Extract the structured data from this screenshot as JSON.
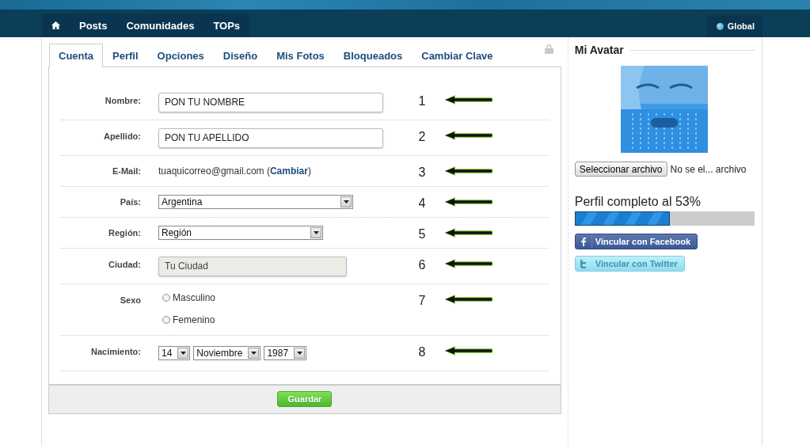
{
  "nav": {
    "items": [
      {
        "kind": "home",
        "selected": false
      },
      {
        "kind": "text",
        "label": "Posts",
        "selected": false
      },
      {
        "kind": "text",
        "label": "Comunidades",
        "selected": false
      },
      {
        "kind": "text",
        "label": "TOPs",
        "selected": false
      }
    ],
    "region_button": {
      "label": "Global"
    }
  },
  "tabs": [
    {
      "label": "Cuenta",
      "selected": true
    },
    {
      "label": "Perfil",
      "selected": false
    },
    {
      "label": "Opciones",
      "selected": false
    },
    {
      "label": "Diseño",
      "selected": false
    },
    {
      "label": "Mis Fotos",
      "selected": false
    },
    {
      "label": "Bloqueados",
      "selected": false
    },
    {
      "label": "Cambiar Clave",
      "selected": false
    }
  ],
  "form": {
    "rows": [
      {
        "kind": "text",
        "label": "Nombre:",
        "value": "PON TU NOMBRE",
        "disabled": false,
        "annotation": "1"
      },
      {
        "kind": "text",
        "label": "Apellido:",
        "value": "PON TU APELLIDO",
        "disabled": false,
        "annotation": "2"
      },
      {
        "kind": "email",
        "label": "E-Mail:",
        "value": "tuaquicorreo@gmail.com",
        "link_open": "(",
        "link": "Cambiar",
        "link_close": ")",
        "annotation": "3"
      },
      {
        "kind": "select",
        "label": "País:",
        "value": "Argentina",
        "annotation": "4"
      },
      {
        "kind": "select",
        "label": "Región:",
        "value": "Región",
        "annotation": "5"
      },
      {
        "kind": "text",
        "label": "Ciudad:",
        "value": "Tu Ciudad",
        "disabled": true,
        "annotation": "6"
      },
      {
        "kind": "radio",
        "label": "Sexo",
        "options": [
          {
            "label": "Masculino",
            "selected": false
          },
          {
            "label": "Femenino",
            "selected": false
          }
        ],
        "annotation": "7"
      },
      {
        "kind": "date",
        "label": "Nacimiento:",
        "parts": [
          "14",
          "Noviembre",
          "1987"
        ],
        "annotation": "8"
      }
    ],
    "save_button": "Guardar"
  },
  "sidebar": {
    "title": "Mi Avatar",
    "file_button": "Seleccionar archivo",
    "file_status": "No se el... archivo",
    "progress": {
      "label": "Perfil completo al 53%",
      "level": 0.53
    },
    "social_buttons": [
      {
        "kind": "facebook",
        "label": "Vincular con Facebook"
      },
      {
        "kind": "twitter",
        "label": "Vincular con Twitter"
      }
    ]
  }
}
